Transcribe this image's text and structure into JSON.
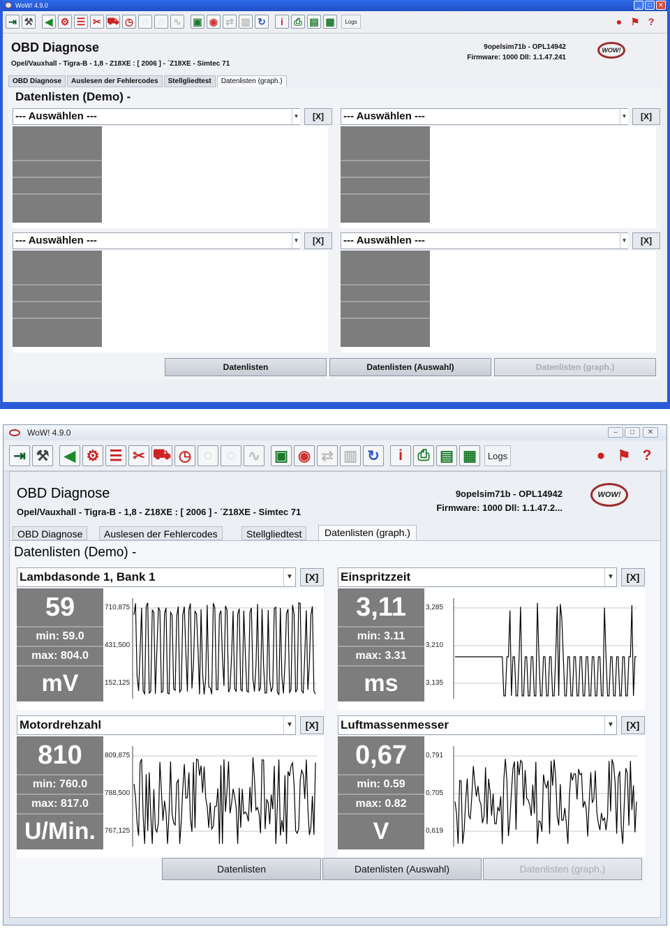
{
  "window_top": {
    "title": "WoW! 4.9.0",
    "logs_label": "Logs",
    "app_title": "OBD Diagnose",
    "vehicle": "Opel/Vauxhall - Tigra-B - 1,8 - Z18XE : [ 2006 ] - ´Z18XE - Simtec 71",
    "ecu_line1": "9opelsim71b - OPL14942",
    "ecu_line2": "Firmware: 1000  Dll: 1.1.47.241",
    "logo_text": "WOW!",
    "tabs": [
      "OBD Diagnose",
      "Auslesen der Fehlercodes",
      "Stellgliedtest",
      "Datenlisten (graph.)"
    ],
    "section_title": "Datenlisten (Demo) -",
    "selector_placeholder": "--- Auswählen ---",
    "remove_label": "[X]",
    "buttons": [
      "Datenlisten",
      "Datenlisten (Auswahl)",
      "Datenlisten (graph.)"
    ]
  },
  "window_bottom": {
    "title": "WoW! 4.9.0",
    "logs_label": "Logs",
    "app_title": "OBD Diagnose",
    "vehicle": "Opel/Vauxhall - Tigra-B - 1,8 - Z18XE : [ 2006 ] - ´Z18XE - Simtec 71",
    "ecu_line1": "9opelsim71b - OPL14942",
    "ecu_line2": "Firmware: 1000  Dll: 1.1.47.2...",
    "logo_text": "WOW!",
    "tabs": [
      "OBD Diagnose",
      "Auslesen der Fehlercodes",
      "Stellgliedtest",
      "Datenlisten (graph.)"
    ],
    "section_title": "Datenlisten (Demo) -",
    "remove_label": "[X]",
    "buttons": [
      "Datenlisten",
      "Datenlisten (Auswahl)",
      "Datenlisten (graph.)"
    ],
    "panels": [
      {
        "name": "Lambdasonde 1, Bank 1",
        "value": "59",
        "min": "min: 59.0",
        "max": "max: 804.0",
        "unit": "mV",
        "ticks": [
          "710,875",
          "431,500",
          "152,125"
        ]
      },
      {
        "name": "Einspritzzeit",
        "value": "3,11",
        "min": "min: 3.11",
        "max": "max: 3.31",
        "unit": "ms",
        "ticks": [
          "3,285",
          "3,210",
          "3,135"
        ]
      },
      {
        "name": "Motordrehzahl",
        "value": "810",
        "min": "min: 760.0",
        "max": "max: 817.0",
        "unit": "U/Min.",
        "ticks": [
          "809,875",
          "788,500",
          "767,125"
        ]
      },
      {
        "name": "Luftmassenmesser",
        "value": "0,67",
        "min": "min: 0.59",
        "max": "max: 0.82",
        "unit": "V",
        "ticks": [
          "0,791",
          "0,705",
          "0,619"
        ]
      }
    ]
  },
  "colors": {
    "value_box": "#7d7d7d",
    "titlebar_xp": "#2f6ae8",
    "logo_ring": "#9c2d2d"
  }
}
